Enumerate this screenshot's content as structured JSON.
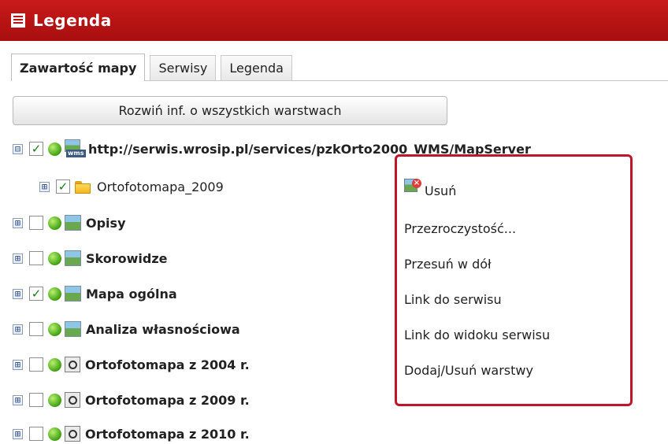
{
  "window": {
    "title": "Legenda",
    "icon": "legend-window-icon"
  },
  "tabs": [
    {
      "label": "Zawartość mapy",
      "active": true
    },
    {
      "label": "Serwisy",
      "active": false
    },
    {
      "label": "Legenda",
      "active": false
    }
  ],
  "expand_button": {
    "label": "Rozwiń inf. o wszystkich warstwach"
  },
  "tree": {
    "service": {
      "expander": "⊟",
      "checked": true,
      "url": "http://serwis.wrosip.pl/services/pzkOrto2000_WMS/MapServer",
      "badge": "wms"
    },
    "sublayer": {
      "expander": "⊞",
      "checked": true,
      "label": "Ortofotomapa_2009"
    },
    "layers": [
      {
        "expander": "⊞",
        "checked": false,
        "label": "Opisy",
        "icon": "image-layer-icon"
      },
      {
        "expander": "⊞",
        "checked": false,
        "label": "Skorowidze",
        "icon": "image-layer-icon"
      },
      {
        "expander": "⊞",
        "checked": true,
        "label": "Mapa ogólna",
        "icon": "image-layer-icon"
      },
      {
        "expander": "⊞",
        "checked": false,
        "label": "Analiza własnościowa",
        "icon": "image-layer-icon"
      },
      {
        "expander": "⊞",
        "checked": false,
        "label": "Ortofotomapa z 2004 r.",
        "icon": "gis-service-icon"
      },
      {
        "expander": "⊞",
        "checked": false,
        "label": "Ortofotomapa z 2009 r.",
        "icon": "gis-service-icon"
      },
      {
        "expander": "⊞",
        "checked": false,
        "label": "Ortofotomapa z 2010 r.",
        "icon": "gis-service-icon"
      }
    ]
  },
  "context_menu": {
    "items": [
      {
        "label": "Usuń",
        "icon": "delete-layer-icon"
      },
      {
        "label": "Przezroczystość..."
      },
      {
        "label": "Przesuń w dół"
      },
      {
        "label": "Link do serwisu"
      },
      {
        "label": "Link do widoku serwisu"
      },
      {
        "label": "Dodaj/Usuń warstwy"
      }
    ]
  },
  "colors": {
    "title_bar": "#b31212",
    "menu_border": "#c0142a",
    "status_green": "#3fa010"
  }
}
